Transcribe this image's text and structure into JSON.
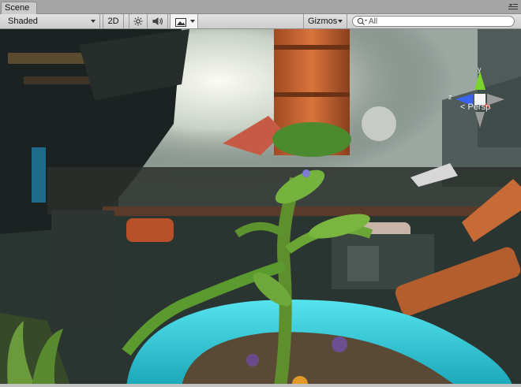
{
  "tab": {
    "title": "Scene"
  },
  "toolbar": {
    "draw_mode": "Shaded",
    "mode_2d": "2D",
    "gizmos": "Gizmos",
    "search": {
      "placeholder": "All",
      "value": ""
    }
  },
  "icons": {
    "tab_menu": "menu-lines-icon",
    "lighting": "sun-icon",
    "audio": "speaker-icon",
    "effects": "image-icon",
    "search": "search-icon"
  },
  "gizmo": {
    "projection": "< Persp",
    "axes": {
      "y": "y",
      "x": "x",
      "z": "z"
    },
    "colors": {
      "y": "#7bd32e",
      "x": "#e04a2f",
      "z": "#3a64f0"
    }
  }
}
